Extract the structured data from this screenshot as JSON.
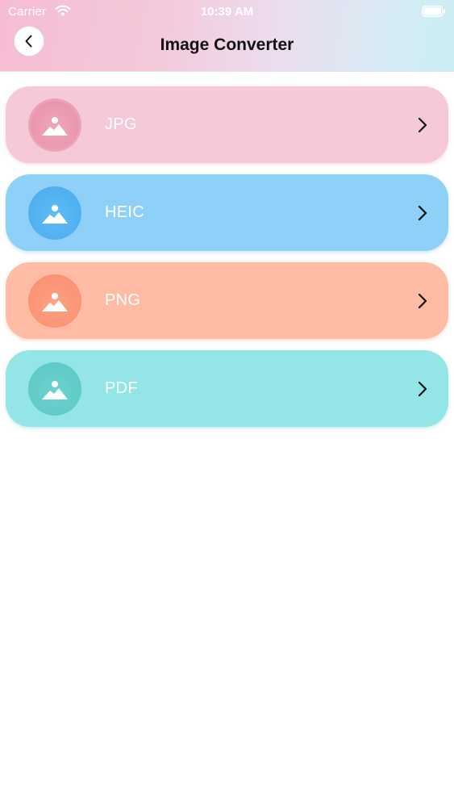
{
  "status_bar": {
    "carrier": "Carrier",
    "time": "10:39 AM",
    "wifi_icon": "wifi-icon",
    "battery_icon": "battery-icon"
  },
  "nav": {
    "title": "Image Converter",
    "back_icon": "chevron-left-icon"
  },
  "formats": [
    {
      "label": "JPG",
      "icon": "image-icon",
      "color": "#f5c9d7",
      "accent": "#e995ad"
    },
    {
      "label": "HEIC",
      "icon": "image-icon",
      "color": "#8ed0f8",
      "accent": "#4fb0f0"
    },
    {
      "label": "PNG",
      "icon": "image-icon",
      "color": "#ffbba4",
      "accent": "#fb9274"
    },
    {
      "label": "PDF",
      "icon": "image-icon",
      "color": "#94e6e6",
      "accent": "#5fcac7"
    }
  ]
}
